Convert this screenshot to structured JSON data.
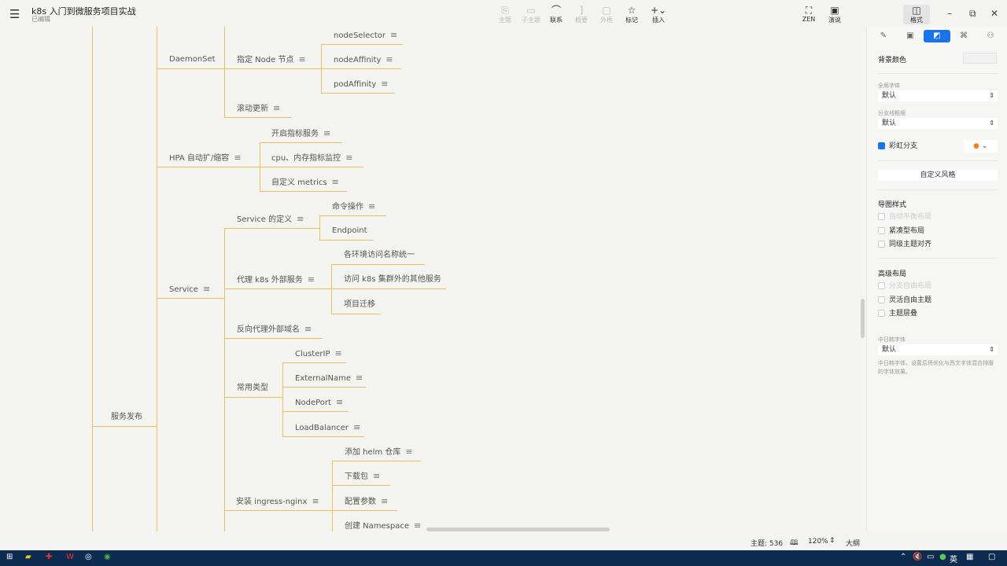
{
  "app": {
    "title": "k8s 入门到微服务项目实战",
    "subtitle": "已编辑"
  },
  "toolbar": [
    {
      "label": "主题",
      "icon": "topic-icon",
      "enabled": false
    },
    {
      "label": "子主题",
      "icon": "subtopic-icon",
      "enabled": false
    },
    {
      "label": "联系",
      "icon": "relationship-icon",
      "enabled": true
    },
    {
      "label": "概要",
      "icon": "summary-icon",
      "enabled": false
    },
    {
      "label": "外框",
      "icon": "boundary-icon",
      "enabled": false
    },
    {
      "label": "标记",
      "icon": "star-icon",
      "enabled": true
    },
    {
      "label": "插入",
      "icon": "plus-icon",
      "enabled": true
    },
    {
      "label": "ZEN",
      "icon": "fullscreen-icon",
      "enabled": true
    },
    {
      "label": "演说",
      "icon": "play-icon",
      "enabled": true
    },
    {
      "label": "格式",
      "icon": "panel-icon",
      "enabled": true
    }
  ],
  "mindmap": {
    "nodes": [
      "服务发布",
      "DaemonSet",
      "指定 Node 节点",
      "nodeSelector",
      "nodeAffinity",
      "podAffinity",
      "滚动更新",
      "HPA 自动扩/缩容",
      "开启指标服务",
      "cpu、内存指标监控",
      "自定义 metrics",
      "Service",
      "Service 的定义",
      "命令操作",
      "Endpoint",
      "代理 k8s 外部服务",
      "各环境访问名称统一",
      "访问 k8s 集群外的其他服务",
      "项目迁移",
      "反向代理外部域名",
      "常用类型",
      "ClusterIP",
      "ExternalName",
      "NodePort",
      "LoadBalancer",
      "安装 ingress-nginx",
      "添加 helm 仓库",
      "下载包",
      "配置参数",
      "创建 Namespace"
    ]
  },
  "panel": {
    "bg_color_label": "背景颜色",
    "font_label": "全局字体",
    "font_value": "默认",
    "branch_label": "分支线粗细",
    "branch_value": "默认",
    "rainbow_label": "彩虹分支",
    "rainbow_checked": true,
    "custom_style": "自定义风格",
    "map_style_title": "导图样式",
    "map_style": [
      "自动平衡布局",
      "紧凑型布局",
      "同级主题对齐"
    ],
    "advanced_title": "高级布局",
    "advanced": [
      "分支自由布局",
      "灵活自由主题",
      "主题层叠"
    ],
    "cjk_label": "中日韩字体",
    "cjk_value": "默认",
    "cjk_desc": "中日韩字体，设置后将优化与西文字体混合排版的字体效果。"
  },
  "status": {
    "topics": "主题: 536",
    "zoom": "120%",
    "outline": "大纲"
  },
  "tray": {
    "lang": "英"
  },
  "colors": {
    "branch": "#e9c25a",
    "accent": "#1a73e8",
    "taskbar": "#0d2b4e"
  }
}
